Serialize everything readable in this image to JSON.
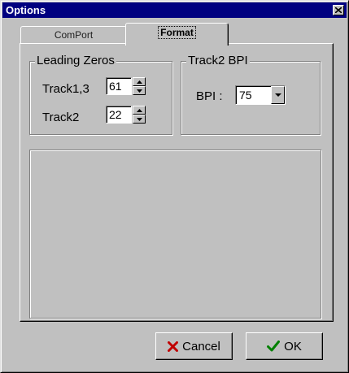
{
  "window": {
    "title": "Options"
  },
  "tabs": [
    {
      "label": "ComPort",
      "active": false
    },
    {
      "label": "Format",
      "active": true
    }
  ],
  "leading_zeros": {
    "title": "Leading Zeros",
    "track13_label": "Track1,3",
    "track13_value": "61",
    "track2_label": "Track2",
    "track2_value": "22"
  },
  "track2_bpi": {
    "title": "Track2 BPI",
    "bpi_label": "BPI :",
    "bpi_value": "75"
  },
  "buttons": {
    "cancel_label": "Cancel",
    "ok_label": "OK"
  },
  "colors": {
    "title_bar": "#000080",
    "face": "#c0c0c0",
    "cancel_icon": "#c00000",
    "ok_icon": "#008000"
  },
  "icons": {
    "close": "close-icon",
    "cancel": "x-icon",
    "ok": "check-icon",
    "spin_up": "arrow-up-icon",
    "spin_down": "arrow-down-icon",
    "dropdown": "chevron-down-icon"
  }
}
